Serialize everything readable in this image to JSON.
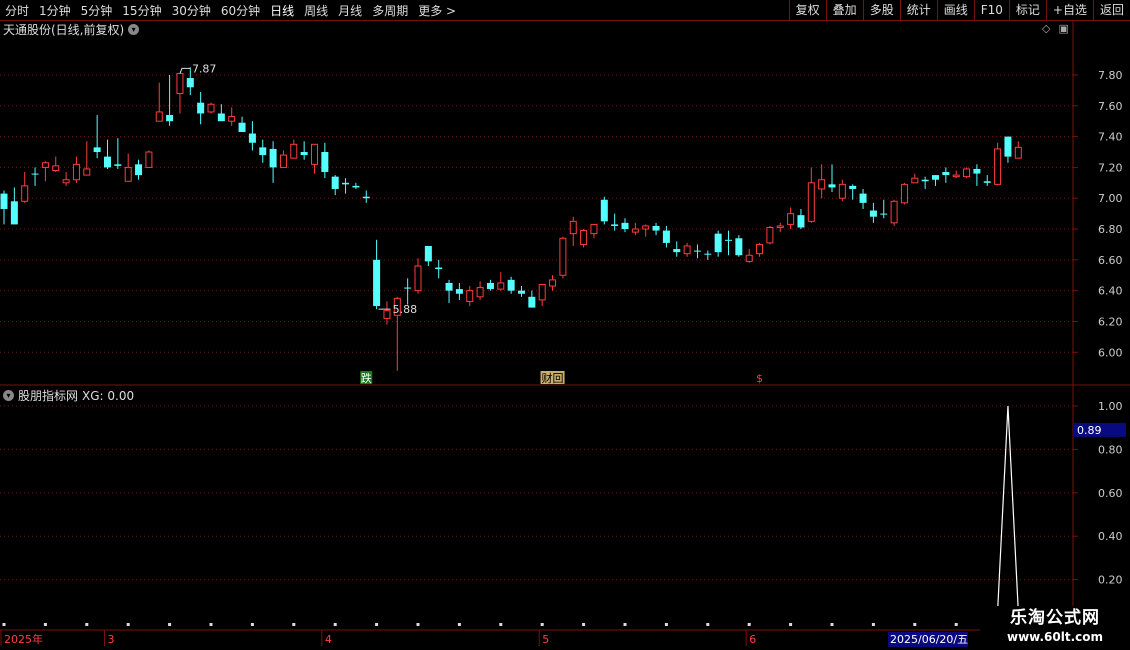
{
  "toolbar": {
    "left": [
      "分时",
      "1分钟",
      "5分钟",
      "15分钟",
      "30分钟",
      "60分钟",
      "日线",
      "周线",
      "月线",
      "多周期",
      "更多 >"
    ],
    "right": [
      "复权",
      "叠加",
      "多股",
      "统计",
      "画线",
      "F10",
      "标记",
      "+自选",
      "返回"
    ]
  },
  "main_title": "天通股份(日线,前复权)",
  "indicator_title": "股朋指标网",
  "indicator_value": "XG: 0.00",
  "logo": {
    "line1": "乐淘公式网",
    "line2": "www.60lt.com"
  },
  "corner_icons": [
    "diamond-icon",
    "panel-icon"
  ],
  "colors": {
    "up": "#ff3c3c",
    "down": "#54ffff",
    "grid": "#7a1010",
    "axis_text": "#cccccc",
    "indicator_line": "#ffffff",
    "badge_bg": "#0a0a80"
  },
  "chart_data": [
    {
      "type": "candlestick",
      "title": "天通股份(日线,前复权)",
      "ylim": [
        5.82,
        8.04
      ],
      "yticks": [
        "7.80",
        "7.60",
        "7.40",
        "7.20",
        "7.00",
        "6.80",
        "6.60",
        "6.40",
        "6.20",
        "6.00"
      ],
      "annotations": [
        {
          "text": "7.87",
          "date_index": 17,
          "kind": "high"
        },
        {
          "text": "5.88",
          "date_index": 36,
          "kind": "low"
        }
      ],
      "markers": [
        {
          "text": "跌",
          "date_index": 35
        },
        {
          "text": "财回",
          "date_index": 53
        },
        {
          "text": "$",
          "date_index": 73
        }
      ],
      "ohlc": [
        [
          7.03,
          6.93,
          7.05,
          6.83
        ],
        [
          6.98,
          6.83,
          7.07,
          6.83
        ],
        [
          6.98,
          7.08,
          7.17,
          6.97
        ],
        [
          7.16,
          7.16,
          7.2,
          7.08
        ],
        [
          7.2,
          7.23,
          7.24,
          7.11
        ],
        [
          7.18,
          7.21,
          7.27,
          7.17
        ],
        [
          7.1,
          7.12,
          7.17,
          7.08
        ],
        [
          7.12,
          7.22,
          7.27,
          7.1
        ],
        [
          7.15,
          7.19,
          7.37,
          7.15
        ],
        [
          7.33,
          7.3,
          7.54,
          7.26
        ],
        [
          7.27,
          7.2,
          7.38,
          7.19
        ],
        [
          7.22,
          7.21,
          7.39,
          7.19
        ],
        [
          7.11,
          7.2,
          7.29,
          7.11
        ],
        [
          7.22,
          7.15,
          7.25,
          7.12
        ],
        [
          7.2,
          7.3,
          7.31,
          7.2
        ],
        [
          7.5,
          7.56,
          7.75,
          7.5
        ],
        [
          7.54,
          7.5,
          7.8,
          7.47
        ],
        [
          7.68,
          7.81,
          7.81,
          7.55
        ],
        [
          7.78,
          7.72,
          7.85,
          7.67
        ],
        [
          7.62,
          7.55,
          7.69,
          7.48
        ],
        [
          7.56,
          7.61,
          7.62,
          7.55
        ],
        [
          7.55,
          7.5,
          7.61,
          7.5
        ],
        [
          7.5,
          7.53,
          7.59,
          7.47
        ],
        [
          7.49,
          7.43,
          7.53,
          7.43
        ],
        [
          7.42,
          7.36,
          7.5,
          7.31
        ],
        [
          7.33,
          7.28,
          7.38,
          7.23
        ],
        [
          7.32,
          7.2,
          7.37,
          7.1
        ],
        [
          7.2,
          7.28,
          7.31,
          7.2
        ],
        [
          7.26,
          7.35,
          7.38,
          7.26
        ],
        [
          7.3,
          7.28,
          7.37,
          7.25
        ],
        [
          7.22,
          7.35,
          7.35,
          7.16
        ],
        [
          7.3,
          7.17,
          7.36,
          7.13
        ],
        [
          7.14,
          7.06,
          7.15,
          7.02
        ],
        [
          7.1,
          7.09,
          7.13,
          7.03
        ],
        [
          7.08,
          7.07,
          7.1,
          7.06
        ],
        [
          7.01,
          7.0,
          7.05,
          6.97
        ],
        [
          6.6,
          6.3,
          6.73,
          6.28
        ],
        [
          6.22,
          6.27,
          6.33,
          6.18
        ],
        [
          6.24,
          6.35,
          6.36,
          5.88
        ],
        [
          6.42,
          6.42,
          6.48,
          6.31
        ],
        [
          6.4,
          6.56,
          6.61,
          6.38
        ],
        [
          6.69,
          6.59,
          6.69,
          6.56
        ],
        [
          6.55,
          6.54,
          6.6,
          6.48
        ],
        [
          6.45,
          6.4,
          6.47,
          6.32
        ],
        [
          6.41,
          6.38,
          6.45,
          6.34
        ],
        [
          6.33,
          6.4,
          6.43,
          6.3
        ],
        [
          6.36,
          6.42,
          6.46,
          6.34
        ],
        [
          6.45,
          6.41,
          6.47,
          6.4
        ],
        [
          6.41,
          6.45,
          6.52,
          6.4
        ],
        [
          6.47,
          6.4,
          6.49,
          6.38
        ],
        [
          6.4,
          6.38,
          6.43,
          6.36
        ],
        [
          6.36,
          6.29,
          6.4,
          6.29
        ],
        [
          6.34,
          6.44,
          6.44,
          6.3
        ],
        [
          6.43,
          6.47,
          6.5,
          6.4
        ],
        [
          6.5,
          6.74,
          6.75,
          6.48
        ],
        [
          6.77,
          6.85,
          6.88,
          6.69
        ],
        [
          6.7,
          6.79,
          6.8,
          6.68
        ],
        [
          6.77,
          6.83,
          6.83,
          6.74
        ],
        [
          6.99,
          6.85,
          7.01,
          6.83
        ],
        [
          6.83,
          6.82,
          6.9,
          6.79
        ],
        [
          6.84,
          6.8,
          6.87,
          6.78
        ],
        [
          6.78,
          6.8,
          6.84,
          6.76
        ],
        [
          6.8,
          6.82,
          6.83,
          6.75
        ],
        [
          6.82,
          6.79,
          6.84,
          6.76
        ],
        [
          6.79,
          6.71,
          6.82,
          6.68
        ],
        [
          6.67,
          6.65,
          6.72,
          6.62
        ],
        [
          6.64,
          6.69,
          6.71,
          6.62
        ],
        [
          6.66,
          6.66,
          6.7,
          6.61
        ],
        [
          6.64,
          6.64,
          6.66,
          6.6
        ],
        [
          6.77,
          6.65,
          6.79,
          6.62
        ],
        [
          6.73,
          6.73,
          6.79,
          6.63
        ],
        [
          6.74,
          6.63,
          6.76,
          6.62
        ],
        [
          6.59,
          6.63,
          6.67,
          6.58
        ],
        [
          6.64,
          6.7,
          6.71,
          6.62
        ],
        [
          6.71,
          6.81,
          6.82,
          6.7
        ],
        [
          6.81,
          6.82,
          6.84,
          6.78
        ],
        [
          6.83,
          6.9,
          6.94,
          6.8
        ],
        [
          6.89,
          6.81,
          6.93,
          6.8
        ],
        [
          6.85,
          7.1,
          7.2,
          6.84
        ],
        [
          7.06,
          7.12,
          7.22,
          7.0
        ],
        [
          7.09,
          7.07,
          7.22,
          7.04
        ],
        [
          7.0,
          7.09,
          7.12,
          6.98
        ],
        [
          7.08,
          7.06,
          7.09,
          6.99
        ],
        [
          7.03,
          6.97,
          7.06,
          6.93
        ],
        [
          6.92,
          6.88,
          6.97,
          6.84
        ],
        [
          6.9,
          6.9,
          6.99,
          6.87
        ],
        [
          6.84,
          6.98,
          6.99,
          6.82
        ],
        [
          6.97,
          7.09,
          7.1,
          6.96
        ],
        [
          7.1,
          7.13,
          7.16,
          7.1
        ],
        [
          7.12,
          7.11,
          7.14,
          7.06
        ],
        [
          7.15,
          7.12,
          7.15,
          7.08
        ],
        [
          7.17,
          7.15,
          7.2,
          7.1
        ],
        [
          7.14,
          7.15,
          7.18,
          7.13
        ],
        [
          7.14,
          7.19,
          7.2,
          7.13
        ],
        [
          7.19,
          7.16,
          7.22,
          7.08
        ],
        [
          7.11,
          7.1,
          7.15,
          7.08
        ],
        [
          7.09,
          7.32,
          7.36,
          7.09
        ],
        [
          7.4,
          7.27,
          7.4,
          7.23
        ],
        [
          7.26,
          7.33,
          7.37,
          7.26
        ]
      ]
    },
    {
      "type": "line",
      "title": "股朋指标网",
      "series": [
        {
          "name": "XG",
          "values": [
            0,
            0,
            0,
            0,
            0,
            0,
            0,
            0,
            0,
            0,
            0,
            0,
            0,
            0,
            0,
            0,
            0,
            0,
            0,
            0,
            0,
            0,
            0,
            0,
            0,
            0,
            0,
            0,
            0,
            0,
            0,
            0,
            0,
            0,
            0,
            0,
            0,
            0,
            0,
            0,
            0,
            0,
            0,
            0,
            0,
            0,
            0,
            0,
            0,
            0,
            0,
            0,
            0,
            0,
            0,
            0,
            0,
            0,
            0,
            0,
            0,
            0,
            0,
            0,
            0,
            0,
            0,
            0,
            0,
            0,
            0,
            0,
            0,
            0,
            0,
            0,
            0,
            0,
            0,
            0,
            0,
            0,
            0,
            0,
            0,
            0,
            0,
            0,
            0,
            0,
            0,
            0,
            0,
            0,
            0,
            0,
            0,
            1,
            0,
            0
          ]
        }
      ],
      "ylim": [
        0,
        1
      ],
      "yticks": [
        "1.00",
        "0.80",
        "0.60",
        "0.40",
        "0.20"
      ],
      "current_value_label": "0.89"
    }
  ],
  "date_axis": {
    "labels": [
      "2025年",
      "3",
      "4",
      "5",
      "6"
    ],
    "label_indices": [
      0,
      10,
      31,
      52,
      72
    ],
    "current_date": "2025/06/20/五"
  }
}
